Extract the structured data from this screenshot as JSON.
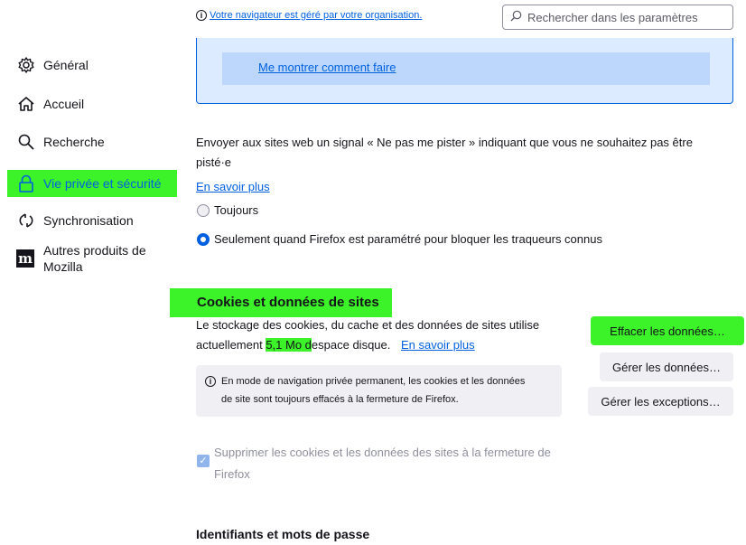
{
  "top": {
    "managed_notice": "Votre navigateur est géré par votre organisation.",
    "search_placeholder": "Rechercher dans les paramètres"
  },
  "info_box": {
    "show_me": "Me montrer comment faire"
  },
  "sidebar": {
    "items": [
      {
        "label": "Général",
        "icon": "gear-icon"
      },
      {
        "label": "Accueil",
        "icon": "home-icon"
      },
      {
        "label": "Recherche",
        "icon": "search-icon"
      },
      {
        "label": "Vie privée et sécurité",
        "icon": "lock-icon"
      },
      {
        "label": "Synchronisation",
        "icon": "sync-icon"
      },
      {
        "label_line1": "Autres produits de",
        "label_line2": "Mozilla",
        "icon": "mozilla-icon"
      }
    ]
  },
  "dnt": {
    "description_line1": "Envoyer aux sites web un signal « Ne pas me pister » indiquant que vous ne souhaitez pas être",
    "description_line2": "pisté·e",
    "learn_more": "En savoir plus",
    "option_always": "Toujours",
    "option_only": "Seulement quand Firefox est paramétré pour bloquer les traqueurs connus",
    "selected": "option_only"
  },
  "cookies": {
    "title": "Cookies et données de sites",
    "usage_line1": "Le stockage des cookies, du cache et des données de sites utilise",
    "usage_prefix": "actuellement ",
    "usage_size": "5,1 Mo d",
    "usage_suffix": "espace disque.",
    "learn_more": "En savoir plus",
    "notice_line1": "En mode de navigation privée permanent, les cookies et les données",
    "notice_line2": "de site sont toujours effacés à la fermeture de Firefox.",
    "btn_clear": "Effacer les données…",
    "btn_manage": "Gérer les données…",
    "btn_exceptions": "Gérer les exceptions…",
    "delete_on_close_line1": "Supprimer les cookies et les données des sites à la fermeture de",
    "delete_on_close_line2": "Firefox",
    "delete_on_close_checked": true
  },
  "logins": {
    "title": "Identifiants et mots de passe"
  },
  "colors": {
    "highlight": "#3cf32a",
    "accent": "#0060df"
  }
}
